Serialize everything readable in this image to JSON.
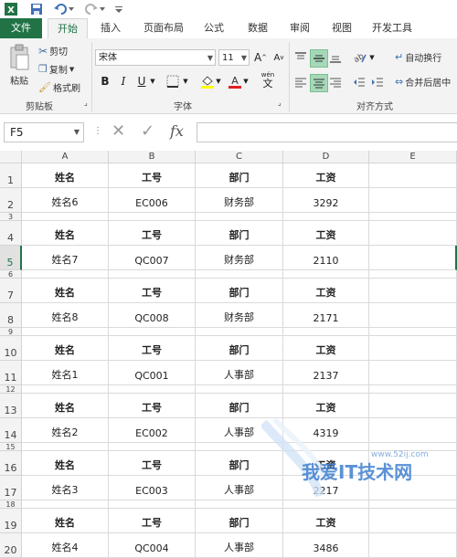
{
  "tabs": {
    "file": "文件",
    "home": "开始",
    "insert": "插入",
    "page_layout": "页面布局",
    "formulas": "公式",
    "data": "数据",
    "review": "审阅",
    "view": "视图",
    "developer": "开发工具"
  },
  "ribbon": {
    "clipboard": {
      "paste": "粘贴",
      "cut": "剪切",
      "copy": "复制",
      "format_painter": "格式刷",
      "label": "剪贴板"
    },
    "font": {
      "name": "宋体",
      "size": "11",
      "bold": "B",
      "italic": "I",
      "underline": "U",
      "grow": "A",
      "shrink": "A",
      "label": "字体",
      "wen": "wén"
    },
    "alignment": {
      "wrap_text": "自动换行",
      "merge_center": "合并后居中",
      "label": "对齐方式"
    }
  },
  "formula_bar": {
    "name_box": "F5",
    "fx": "fx",
    "content": ""
  },
  "columns": [
    "A",
    "B",
    "C",
    "D",
    "E"
  ],
  "headers": [
    "姓名",
    "工号",
    "部门",
    "工资"
  ],
  "rows": [
    {
      "num": "1",
      "type": "header"
    },
    {
      "num": "2",
      "type": "data",
      "cells": [
        "姓名6",
        "EC006",
        "财务部",
        "3292"
      ]
    },
    {
      "num": "3",
      "type": "blank"
    },
    {
      "num": "4",
      "type": "header"
    },
    {
      "num": "5",
      "type": "data",
      "cells": [
        "姓名7",
        "QC007",
        "财务部",
        "2110"
      ],
      "selected": true
    },
    {
      "num": "6",
      "type": "blank"
    },
    {
      "num": "7",
      "type": "header"
    },
    {
      "num": "8",
      "type": "data",
      "cells": [
        "姓名8",
        "QC008",
        "财务部",
        "2171"
      ]
    },
    {
      "num": "9",
      "type": "blank"
    },
    {
      "num": "10",
      "type": "header"
    },
    {
      "num": "11",
      "type": "data",
      "cells": [
        "姓名1",
        "QC001",
        "人事部",
        "2137"
      ]
    },
    {
      "num": "12",
      "type": "blank"
    },
    {
      "num": "13",
      "type": "header"
    },
    {
      "num": "14",
      "type": "data",
      "cells": [
        "姓名2",
        "EC002",
        "人事部",
        "4319"
      ]
    },
    {
      "num": "15",
      "type": "blank"
    },
    {
      "num": "16",
      "type": "header"
    },
    {
      "num": "17",
      "type": "data",
      "cells": [
        "姓名3",
        "EC003",
        "人事部",
        "2217"
      ]
    },
    {
      "num": "18",
      "type": "blank"
    },
    {
      "num": "19",
      "type": "header"
    },
    {
      "num": "20",
      "type": "data",
      "cells": [
        "姓名4",
        "QC004",
        "人事部",
        "3486"
      ]
    }
  ],
  "watermark": {
    "text": "我爱IT技术网",
    "url": "www.52ij.com"
  },
  "colors": {
    "excel_green": "#217346"
  }
}
